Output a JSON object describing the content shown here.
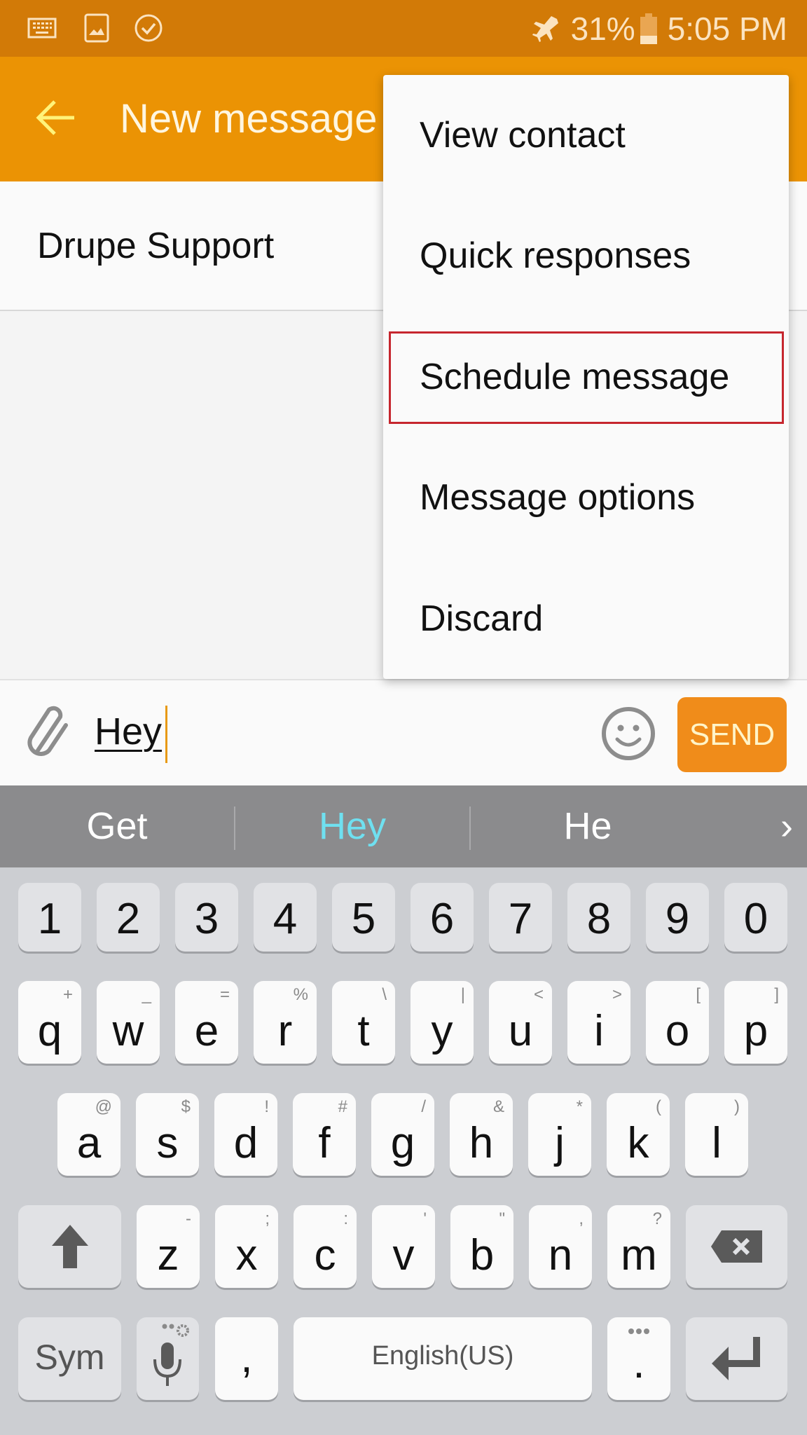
{
  "status_bar": {
    "left_icons": [
      "keyboard-icon",
      "image-icon",
      "check-circle-icon"
    ],
    "airplane_icon": "airplane-icon",
    "battery_percent": "31%",
    "battery_level": 0.31,
    "time": "5:05 PM"
  },
  "header": {
    "back_icon": "arrow-left-icon",
    "title": "New message"
  },
  "recipient": {
    "name": "Drupe Support"
  },
  "overflow_menu": {
    "items": [
      {
        "label": "View contact"
      },
      {
        "label": "Quick responses"
      },
      {
        "label": "Schedule message",
        "highlighted": true
      },
      {
        "label": "Message options"
      },
      {
        "label": "Discard"
      }
    ],
    "highlight_color": "#c6262e"
  },
  "compose": {
    "attach_icon": "paperclip-icon",
    "message_value": "Hey",
    "emoji_icon": "smiley-icon",
    "send_label": "SEND"
  },
  "suggestions": {
    "items": [
      "Get",
      "Hey",
      "He"
    ],
    "selected_index": 1,
    "more_label": "›"
  },
  "keyboard": {
    "number_row": [
      "1",
      "2",
      "3",
      "4",
      "5",
      "6",
      "7",
      "8",
      "9",
      "0"
    ],
    "row1": [
      {
        "key": "q",
        "hint": "+"
      },
      {
        "key": "w",
        "hint": "_"
      },
      {
        "key": "e",
        "hint": "="
      },
      {
        "key": "r",
        "hint": "%"
      },
      {
        "key": "t",
        "hint": "\\"
      },
      {
        "key": "y",
        "hint": "|"
      },
      {
        "key": "u",
        "hint": "<"
      },
      {
        "key": "i",
        "hint": ">"
      },
      {
        "key": "o",
        "hint": "["
      },
      {
        "key": "p",
        "hint": "]"
      }
    ],
    "row2": [
      {
        "key": "a",
        "hint": "@"
      },
      {
        "key": "s",
        "hint": "$"
      },
      {
        "key": "d",
        "hint": "!"
      },
      {
        "key": "f",
        "hint": "#"
      },
      {
        "key": "g",
        "hint": "/"
      },
      {
        "key": "h",
        "hint": "&"
      },
      {
        "key": "j",
        "hint": "*"
      },
      {
        "key": "k",
        "hint": "("
      },
      {
        "key": "l",
        "hint": ")"
      }
    ],
    "row3": [
      {
        "key": "z",
        "hint": "-"
      },
      {
        "key": "x",
        "hint": ";"
      },
      {
        "key": "c",
        "hint": ":"
      },
      {
        "key": "v",
        "hint": "'"
      },
      {
        "key": "b",
        "hint": "\""
      },
      {
        "key": "n",
        "hint": ","
      },
      {
        "key": "m",
        "hint": "?"
      }
    ],
    "shift_icon": "shift-arrow-icon",
    "backspace_icon": "backspace-icon",
    "sym_label": "Sym",
    "mic_icon": "microphone-icon",
    "comma": ",",
    "space_label": "English(US)",
    "period": ".",
    "enter_icon": "enter-icon"
  },
  "colors": {
    "status_bar": "#d27a07",
    "app_bar": "#eb9304",
    "send_button": "#f08c1a",
    "suggestion_selected": "#6fe0f0"
  }
}
